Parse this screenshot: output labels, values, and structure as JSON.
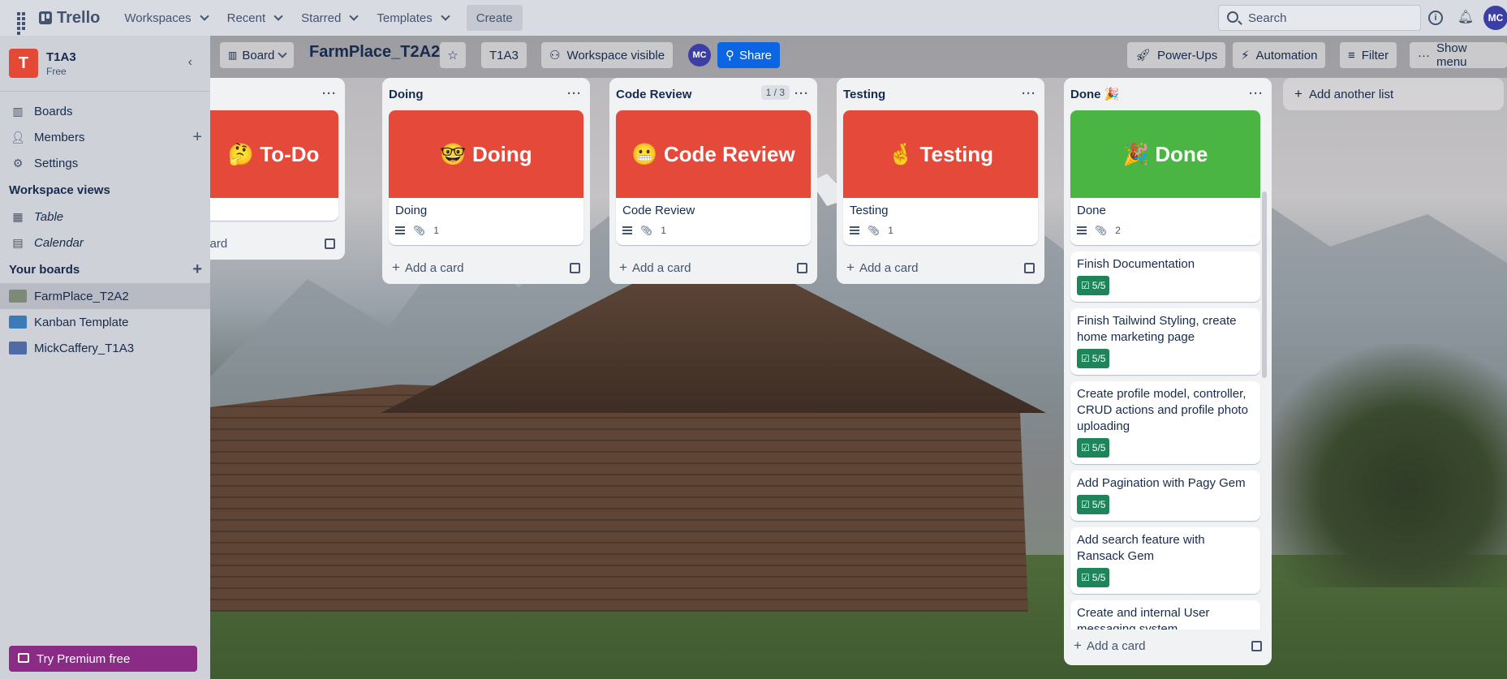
{
  "topbar": {
    "brand": "Trello",
    "menus": [
      "Workspaces",
      "Recent",
      "Starred",
      "Templates"
    ],
    "create": "Create",
    "search_placeholder": "Search",
    "avatar": "MC"
  },
  "sidebar": {
    "workspace_initial": "T",
    "workspace_name": "T1A3",
    "workspace_plan": "Free",
    "nav": [
      "Boards",
      "Members",
      "Settings"
    ],
    "views_heading": "Workspace views",
    "views": [
      "Table",
      "Calendar"
    ],
    "boards_heading": "Your boards",
    "boards": [
      {
        "name": "FarmPlace_T2A2",
        "color": "#7d8a78"
      },
      {
        "name": "Kanban Template",
        "color": "#3c7bb8"
      },
      {
        "name": "MickCaffery_T1A3",
        "color": "#4f6aa6"
      }
    ],
    "premium": "Try Premium free"
  },
  "board_header": {
    "view": "Board",
    "title": "FarmPlace_T2A2",
    "workspace": "T1A3",
    "visibility": "Workspace visible",
    "avatar": "MC",
    "share": "Share",
    "powerups": "Power-Ups",
    "automation": "Automation",
    "filter": "Filter",
    "show_menu": "Show menu"
  },
  "lists": [
    {
      "title": "",
      "cover": "🤔 To-Do",
      "cover_color": "#e5493a",
      "card_title": "",
      "attachments": "",
      "add": "card"
    },
    {
      "title": "Doing",
      "cover": "🤓 Doing",
      "cover_color": "#e5493a",
      "card_title": "Doing",
      "attachments": "1",
      "add": "Add a card"
    },
    {
      "title": "Code Review",
      "count": "1 / 3",
      "cover": "😬 Code Review",
      "cover_color": "#e5493a",
      "card_title": "Code Review",
      "attachments": "1",
      "add": "Add a card"
    },
    {
      "title": "Testing",
      "cover": "🤞 Testing",
      "cover_color": "#e5493a",
      "card_title": "Testing",
      "attachments": "1",
      "add": "Add a card"
    }
  ],
  "done_list": {
    "title": "Done 🎉",
    "cover": "🎉 Done",
    "cover_color": "#4bb543",
    "first_card": "Done",
    "first_attachments": "2",
    "cards": [
      {
        "title": "Finish Documentation",
        "check": "5/5"
      },
      {
        "title": "Finish Tailwind Styling, create home marketing page",
        "check": "5/5"
      },
      {
        "title": "Create profile model, controller, CRUD actions and profile photo uploading",
        "check": "5/5"
      },
      {
        "title": "Add Pagination with Pagy Gem",
        "check": "5/5"
      },
      {
        "title": "Add search feature with Ransack Gem",
        "check": "5/5"
      },
      {
        "title": "Create and internal User messaging system",
        "check": ""
      }
    ],
    "add": "Add a card"
  },
  "add_list": "Add another list"
}
